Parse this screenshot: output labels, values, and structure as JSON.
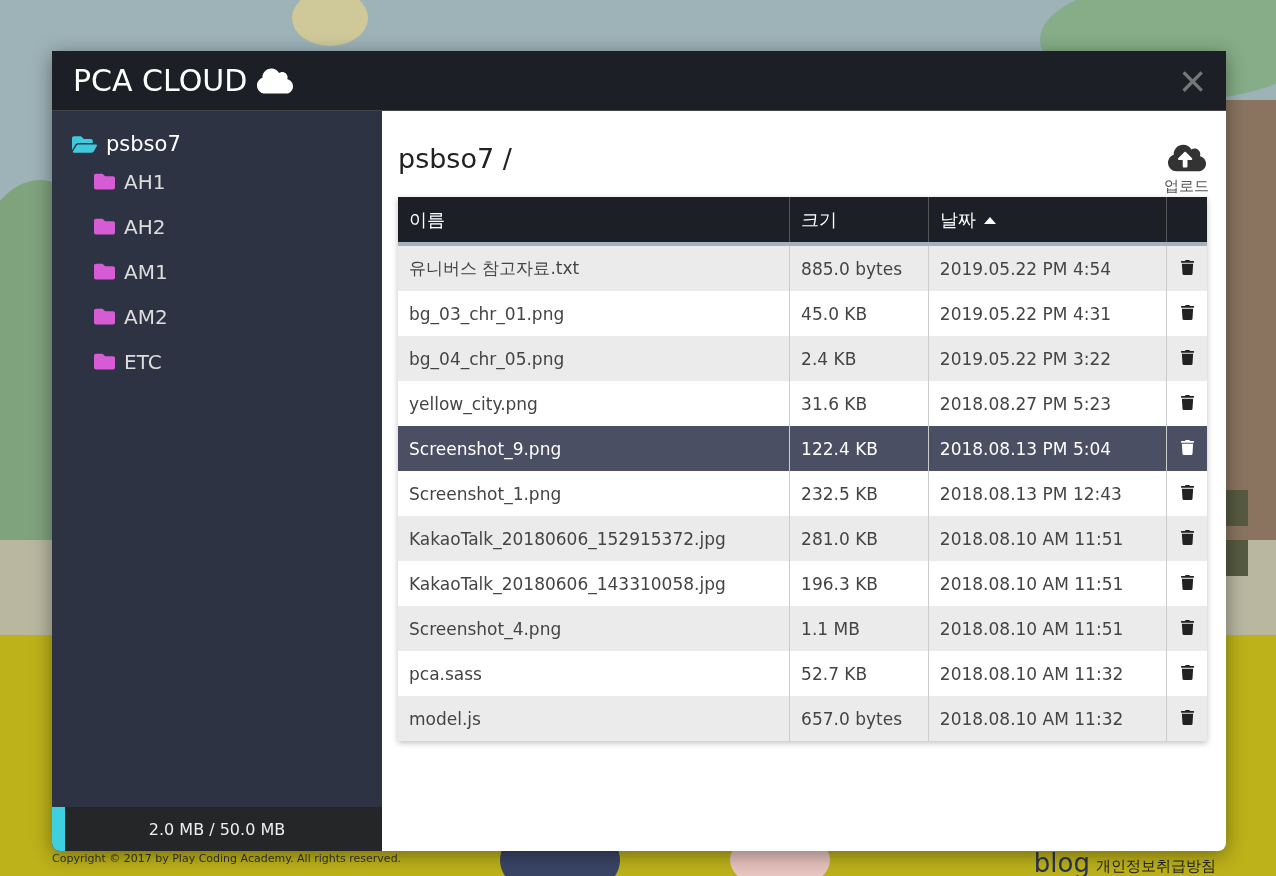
{
  "dialog": {
    "title": "PCA CLOUD",
    "close": "×"
  },
  "sidebar": {
    "root": {
      "label": "psbso7",
      "expanded": true,
      "children": [
        {
          "label": "AH1"
        },
        {
          "label": "AH2"
        },
        {
          "label": "AM1"
        },
        {
          "label": "AM2"
        },
        {
          "label": "ETC"
        }
      ]
    },
    "storage": {
      "level": 0.04,
      "reading": "2.0 MB / 50.0 MB"
    }
  },
  "main": {
    "path": "psbso7 /",
    "upload": "업로드",
    "table": {
      "columns": [
        {
          "label": "이름",
          "sorted": false
        },
        {
          "label": "크기",
          "sorted": false
        },
        {
          "label": "날짜",
          "sorted": true
        }
      ],
      "rows": [
        {
          "name": "유니버스 참고자료.txt",
          "size": "885.0 bytes",
          "date": "2019.05.22 PM 4:54",
          "selected": false
        },
        {
          "name": "bg_03_chr_01.png",
          "size": "45.0 KB",
          "date": "2019.05.22 PM 4:31",
          "selected": false
        },
        {
          "name": "bg_04_chr_05.png",
          "size": "2.4 KB",
          "date": "2019.05.22 PM 3:22",
          "selected": false
        },
        {
          "name": "yellow_city.png",
          "size": "31.6 KB",
          "date": "2018.08.27 PM 5:23",
          "selected": false
        },
        {
          "name": "Screenshot_9.png",
          "size": "122.4 KB",
          "date": "2018.08.13 PM 5:04",
          "selected": true
        },
        {
          "name": "Screenshot_1.png",
          "size": "232.5 KB",
          "date": "2018.08.13 PM 12:43",
          "selected": false
        },
        {
          "name": "KakaoTalk_20180606_152915372.jpg",
          "size": "281.0 KB",
          "date": "2018.08.10 AM 11:51",
          "selected": false
        },
        {
          "name": "KakaoTalk_20180606_143310058.jpg",
          "size": "196.3 KB",
          "date": "2018.08.10 AM 11:51",
          "selected": false
        },
        {
          "name": "Screenshot_4.png",
          "size": "1.1 MB",
          "date": "2018.08.10 AM 11:51",
          "selected": false
        },
        {
          "name": "pca.sass",
          "size": "52.7 KB",
          "date": "2018.08.10 AM 11:32",
          "selected": false
        },
        {
          "name": "model.js",
          "size": "657.0 bytes",
          "date": "2018.08.10 AM 11:32",
          "selected": false
        }
      ]
    }
  },
  "footer": {
    "copyright": "Copyright © 2017 by Play Coding Academy. All rights reserved.",
    "blog": "blog",
    "privacy": "개인정보취급방침"
  }
}
